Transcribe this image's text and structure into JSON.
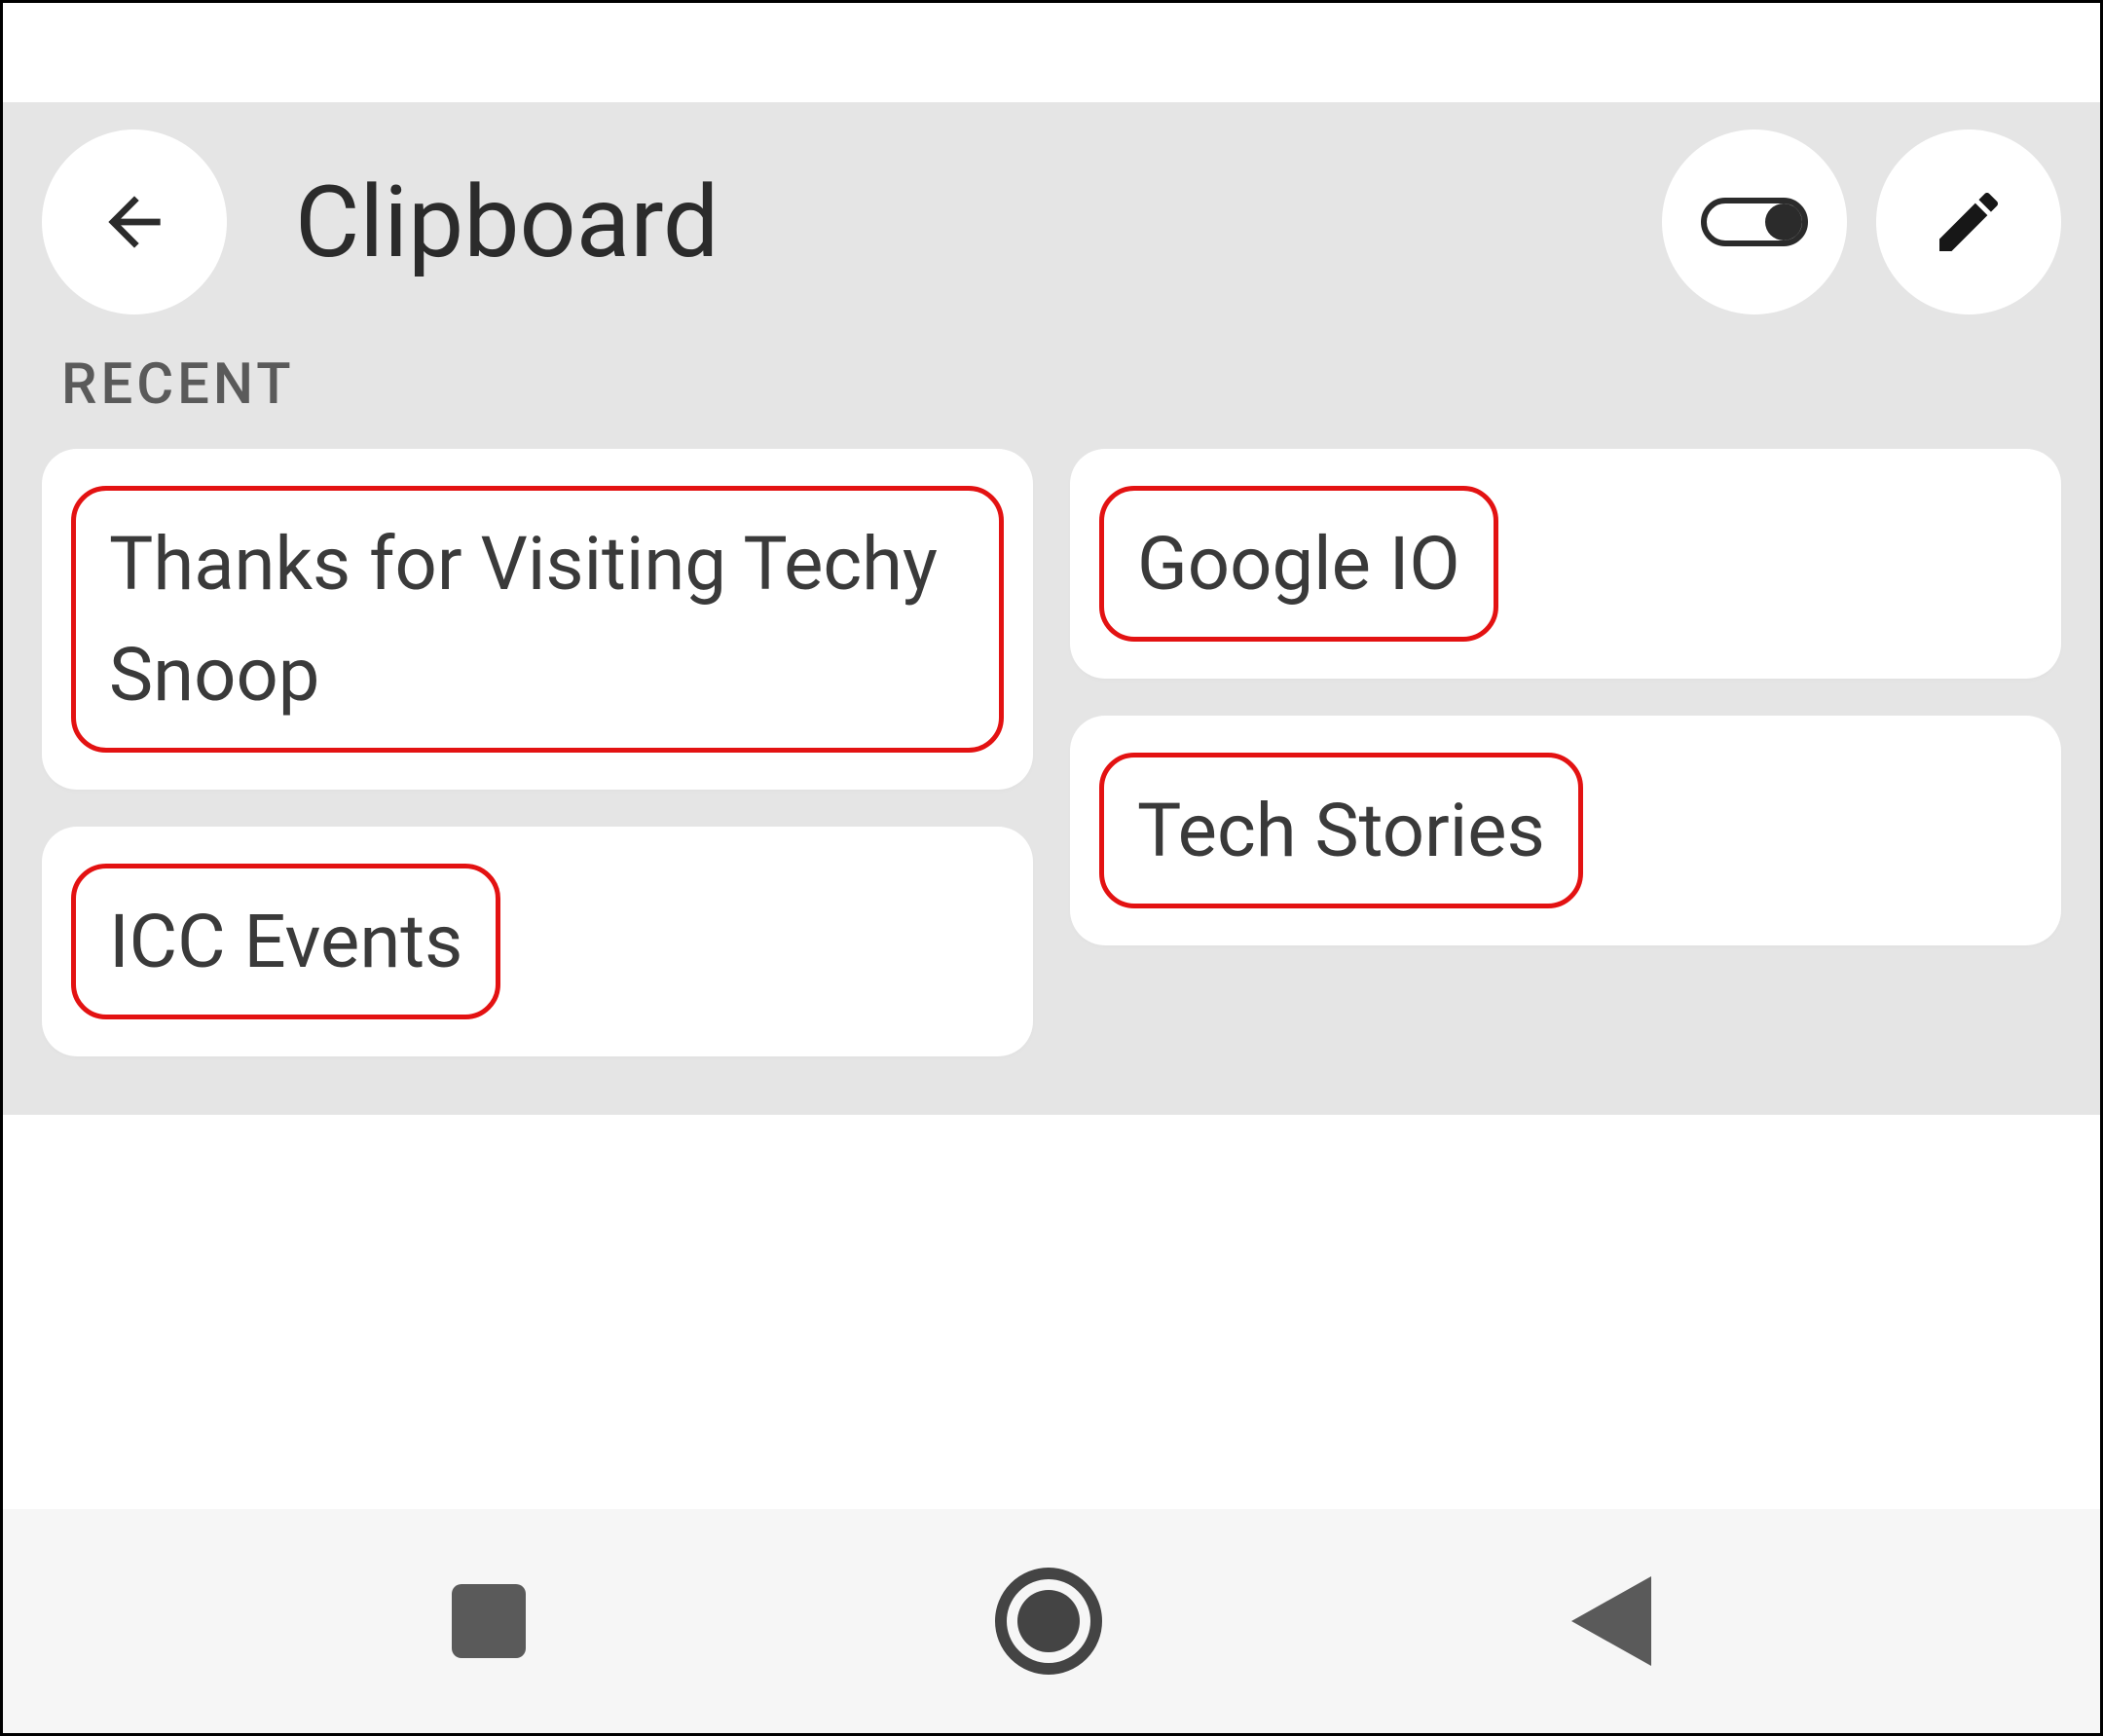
{
  "header": {
    "title": "Clipboard",
    "toggle_state": "on"
  },
  "section": {
    "recent_label": "RECENT"
  },
  "clips": {
    "left": [
      {
        "text": "Thanks for Visiting Techy Snoop"
      },
      {
        "text": "ICC Events"
      }
    ],
    "right": [
      {
        "text": "Google IO"
      },
      {
        "text": "Tech Stories"
      }
    ]
  }
}
